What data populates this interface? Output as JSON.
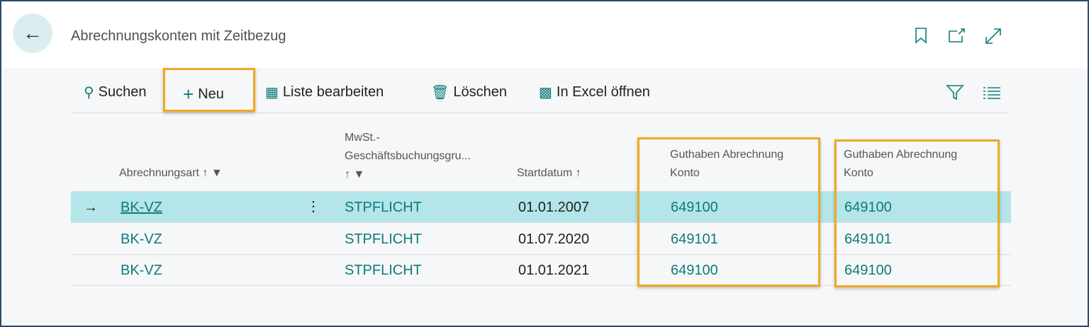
{
  "header": {
    "title": "Abrechnungskonten mit Zeitbezug",
    "icons": [
      "back-arrow-icon",
      "bookmark-icon",
      "open-new-window-icon",
      "expand-icon"
    ]
  },
  "toolbar": {
    "search": "Suchen",
    "new": "Neu",
    "edit_list": "Liste bearbeiten",
    "delete": "Löschen",
    "excel": "In Excel öffnen"
  },
  "columns": {
    "c1": "Abrechnungsart",
    "c2a": "MwSt.-",
    "c2b": "Geschäftsbuchungsgru...",
    "c3": "Startdatum",
    "c4a": "Guthaben Abrechnung",
    "c4b": "Konto",
    "c5a": "Guthaben Abrechnung",
    "c5b": "Konto"
  },
  "rows": [
    {
      "art": "BK-VZ",
      "mwst": "STPFLICHT",
      "start": "01.01.2007",
      "konto1": "649100",
      "konto2": "649100",
      "selected": true
    },
    {
      "art": "BK-VZ",
      "mwst": "STPFLICHT",
      "start": "01.07.2020",
      "konto1": "649101",
      "konto2": "649101"
    },
    {
      "art": "BK-VZ",
      "mwst": "STPFLICHT",
      "start": "01.01.2021",
      "konto1": "649100",
      "konto2": "649100"
    }
  ],
  "colors": {
    "accent": "#0f7b7b",
    "selected_row": "#b3e5e9",
    "highlight": "#f0a820"
  }
}
